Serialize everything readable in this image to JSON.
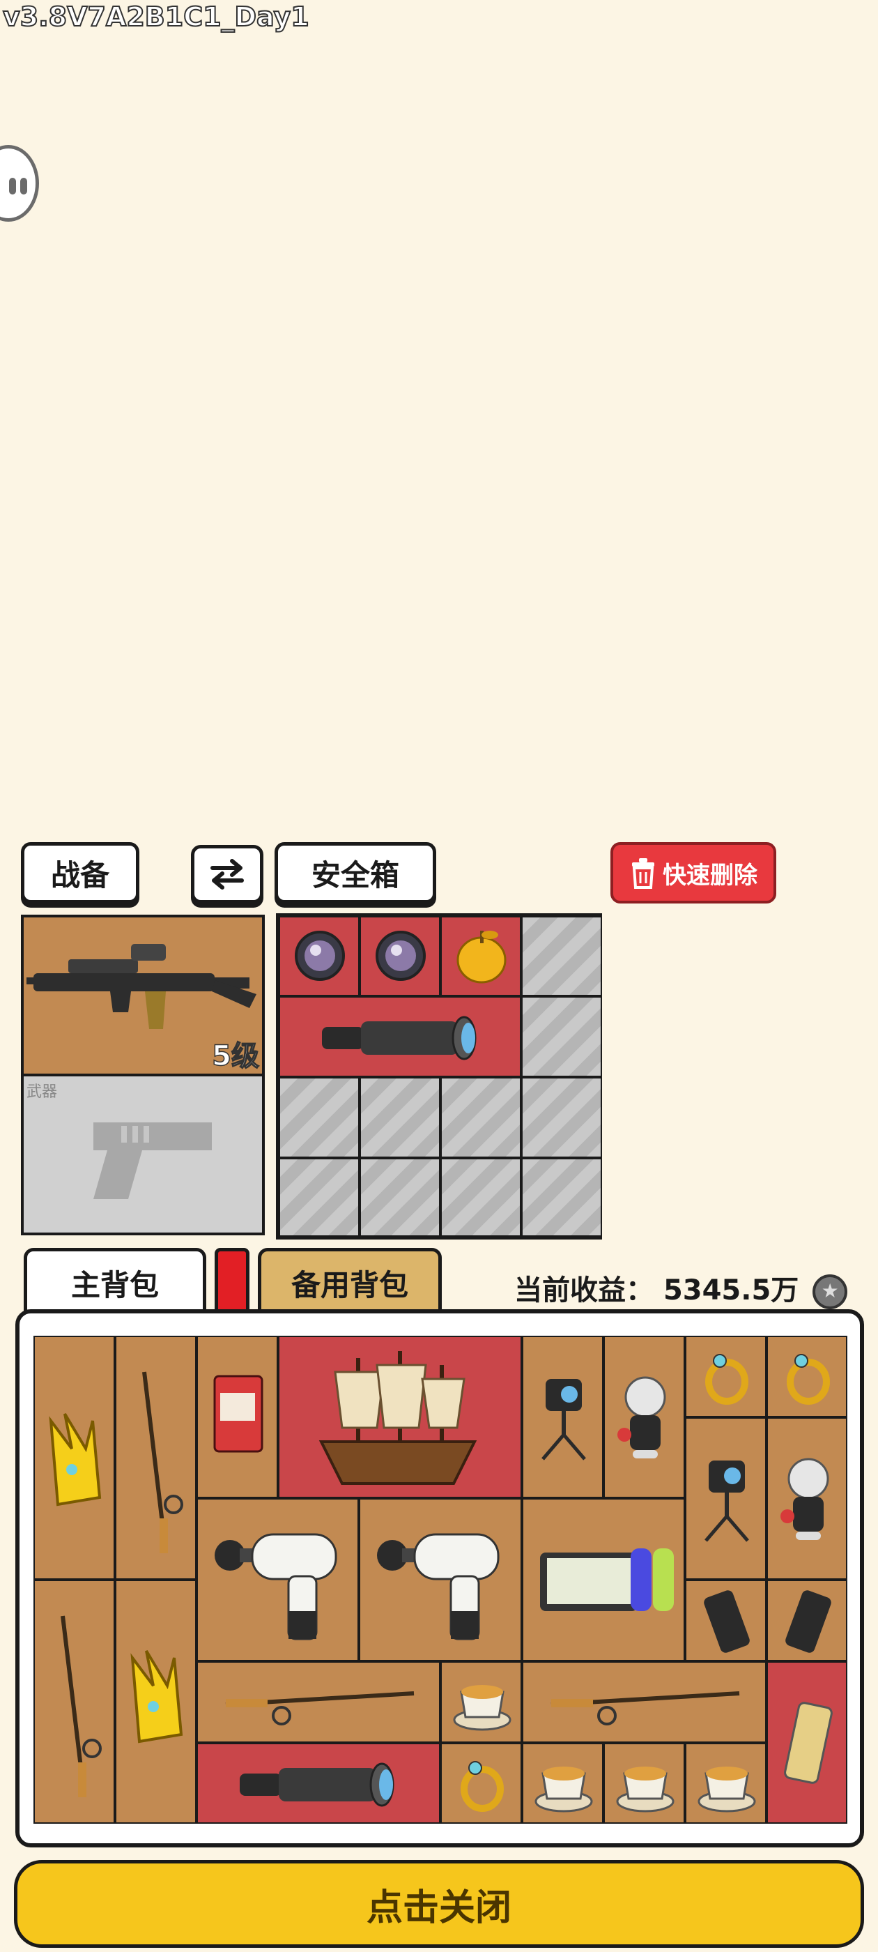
{
  "version": "v3.8V7A2B1C1_Day1",
  "tabs": {
    "equip": "战备",
    "swap_icon": "swap-arrows-icon",
    "safe_box": "安全箱",
    "quick_delete": "快速删除"
  },
  "equipment": {
    "weapon_level": "5级",
    "weapon_slot_label": "武器"
  },
  "bag": {
    "main_tab": "主背包",
    "backup_tab": "备用背包",
    "earnings_label": "当前收益：",
    "earnings_value": "5345.5万"
  },
  "close_button": "点击关闭",
  "colors": {
    "background": "#fcf5e4",
    "cell_brown": "#c28a52",
    "cell_red": "#c9464a",
    "close_yellow": "#f6c61c",
    "delete_red": "#e8393e"
  }
}
